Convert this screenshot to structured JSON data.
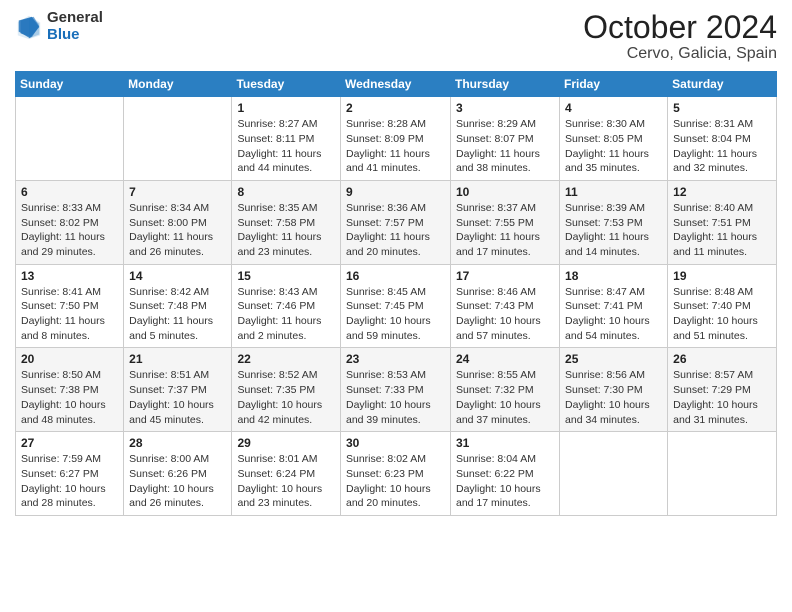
{
  "header": {
    "logo": {
      "line1": "General",
      "line2": "Blue"
    },
    "title": "October 2024",
    "subtitle": "Cervo, Galicia, Spain"
  },
  "weekdays": [
    "Sunday",
    "Monday",
    "Tuesday",
    "Wednesday",
    "Thursday",
    "Friday",
    "Saturday"
  ],
  "weeks": [
    [
      {
        "day": "",
        "sunrise": "",
        "sunset": "",
        "daylight": ""
      },
      {
        "day": "",
        "sunrise": "",
        "sunset": "",
        "daylight": ""
      },
      {
        "day": "1",
        "sunrise": "Sunrise: 8:27 AM",
        "sunset": "Sunset: 8:11 PM",
        "daylight": "Daylight: 11 hours and 44 minutes."
      },
      {
        "day": "2",
        "sunrise": "Sunrise: 8:28 AM",
        "sunset": "Sunset: 8:09 PM",
        "daylight": "Daylight: 11 hours and 41 minutes."
      },
      {
        "day": "3",
        "sunrise": "Sunrise: 8:29 AM",
        "sunset": "Sunset: 8:07 PM",
        "daylight": "Daylight: 11 hours and 38 minutes."
      },
      {
        "day": "4",
        "sunrise": "Sunrise: 8:30 AM",
        "sunset": "Sunset: 8:05 PM",
        "daylight": "Daylight: 11 hours and 35 minutes."
      },
      {
        "day": "5",
        "sunrise": "Sunrise: 8:31 AM",
        "sunset": "Sunset: 8:04 PM",
        "daylight": "Daylight: 11 hours and 32 minutes."
      }
    ],
    [
      {
        "day": "6",
        "sunrise": "Sunrise: 8:33 AM",
        "sunset": "Sunset: 8:02 PM",
        "daylight": "Daylight: 11 hours and 29 minutes."
      },
      {
        "day": "7",
        "sunrise": "Sunrise: 8:34 AM",
        "sunset": "Sunset: 8:00 PM",
        "daylight": "Daylight: 11 hours and 26 minutes."
      },
      {
        "day": "8",
        "sunrise": "Sunrise: 8:35 AM",
        "sunset": "Sunset: 7:58 PM",
        "daylight": "Daylight: 11 hours and 23 minutes."
      },
      {
        "day": "9",
        "sunrise": "Sunrise: 8:36 AM",
        "sunset": "Sunset: 7:57 PM",
        "daylight": "Daylight: 11 hours and 20 minutes."
      },
      {
        "day": "10",
        "sunrise": "Sunrise: 8:37 AM",
        "sunset": "Sunset: 7:55 PM",
        "daylight": "Daylight: 11 hours and 17 minutes."
      },
      {
        "day": "11",
        "sunrise": "Sunrise: 8:39 AM",
        "sunset": "Sunset: 7:53 PM",
        "daylight": "Daylight: 11 hours and 14 minutes."
      },
      {
        "day": "12",
        "sunrise": "Sunrise: 8:40 AM",
        "sunset": "Sunset: 7:51 PM",
        "daylight": "Daylight: 11 hours and 11 minutes."
      }
    ],
    [
      {
        "day": "13",
        "sunrise": "Sunrise: 8:41 AM",
        "sunset": "Sunset: 7:50 PM",
        "daylight": "Daylight: 11 hours and 8 minutes."
      },
      {
        "day": "14",
        "sunrise": "Sunrise: 8:42 AM",
        "sunset": "Sunset: 7:48 PM",
        "daylight": "Daylight: 11 hours and 5 minutes."
      },
      {
        "day": "15",
        "sunrise": "Sunrise: 8:43 AM",
        "sunset": "Sunset: 7:46 PM",
        "daylight": "Daylight: 11 hours and 2 minutes."
      },
      {
        "day": "16",
        "sunrise": "Sunrise: 8:45 AM",
        "sunset": "Sunset: 7:45 PM",
        "daylight": "Daylight: 10 hours and 59 minutes."
      },
      {
        "day": "17",
        "sunrise": "Sunrise: 8:46 AM",
        "sunset": "Sunset: 7:43 PM",
        "daylight": "Daylight: 10 hours and 57 minutes."
      },
      {
        "day": "18",
        "sunrise": "Sunrise: 8:47 AM",
        "sunset": "Sunset: 7:41 PM",
        "daylight": "Daylight: 10 hours and 54 minutes."
      },
      {
        "day": "19",
        "sunrise": "Sunrise: 8:48 AM",
        "sunset": "Sunset: 7:40 PM",
        "daylight": "Daylight: 10 hours and 51 minutes."
      }
    ],
    [
      {
        "day": "20",
        "sunrise": "Sunrise: 8:50 AM",
        "sunset": "Sunset: 7:38 PM",
        "daylight": "Daylight: 10 hours and 48 minutes."
      },
      {
        "day": "21",
        "sunrise": "Sunrise: 8:51 AM",
        "sunset": "Sunset: 7:37 PM",
        "daylight": "Daylight: 10 hours and 45 minutes."
      },
      {
        "day": "22",
        "sunrise": "Sunrise: 8:52 AM",
        "sunset": "Sunset: 7:35 PM",
        "daylight": "Daylight: 10 hours and 42 minutes."
      },
      {
        "day": "23",
        "sunrise": "Sunrise: 8:53 AM",
        "sunset": "Sunset: 7:33 PM",
        "daylight": "Daylight: 10 hours and 39 minutes."
      },
      {
        "day": "24",
        "sunrise": "Sunrise: 8:55 AM",
        "sunset": "Sunset: 7:32 PM",
        "daylight": "Daylight: 10 hours and 37 minutes."
      },
      {
        "day": "25",
        "sunrise": "Sunrise: 8:56 AM",
        "sunset": "Sunset: 7:30 PM",
        "daylight": "Daylight: 10 hours and 34 minutes."
      },
      {
        "day": "26",
        "sunrise": "Sunrise: 8:57 AM",
        "sunset": "Sunset: 7:29 PM",
        "daylight": "Daylight: 10 hours and 31 minutes."
      }
    ],
    [
      {
        "day": "27",
        "sunrise": "Sunrise: 7:59 AM",
        "sunset": "Sunset: 6:27 PM",
        "daylight": "Daylight: 10 hours and 28 minutes."
      },
      {
        "day": "28",
        "sunrise": "Sunrise: 8:00 AM",
        "sunset": "Sunset: 6:26 PM",
        "daylight": "Daylight: 10 hours and 26 minutes."
      },
      {
        "day": "29",
        "sunrise": "Sunrise: 8:01 AM",
        "sunset": "Sunset: 6:24 PM",
        "daylight": "Daylight: 10 hours and 23 minutes."
      },
      {
        "day": "30",
        "sunrise": "Sunrise: 8:02 AM",
        "sunset": "Sunset: 6:23 PM",
        "daylight": "Daylight: 10 hours and 20 minutes."
      },
      {
        "day": "31",
        "sunrise": "Sunrise: 8:04 AM",
        "sunset": "Sunset: 6:22 PM",
        "daylight": "Daylight: 10 hours and 17 minutes."
      },
      {
        "day": "",
        "sunrise": "",
        "sunset": "",
        "daylight": ""
      },
      {
        "day": "",
        "sunrise": "",
        "sunset": "",
        "daylight": ""
      }
    ]
  ]
}
